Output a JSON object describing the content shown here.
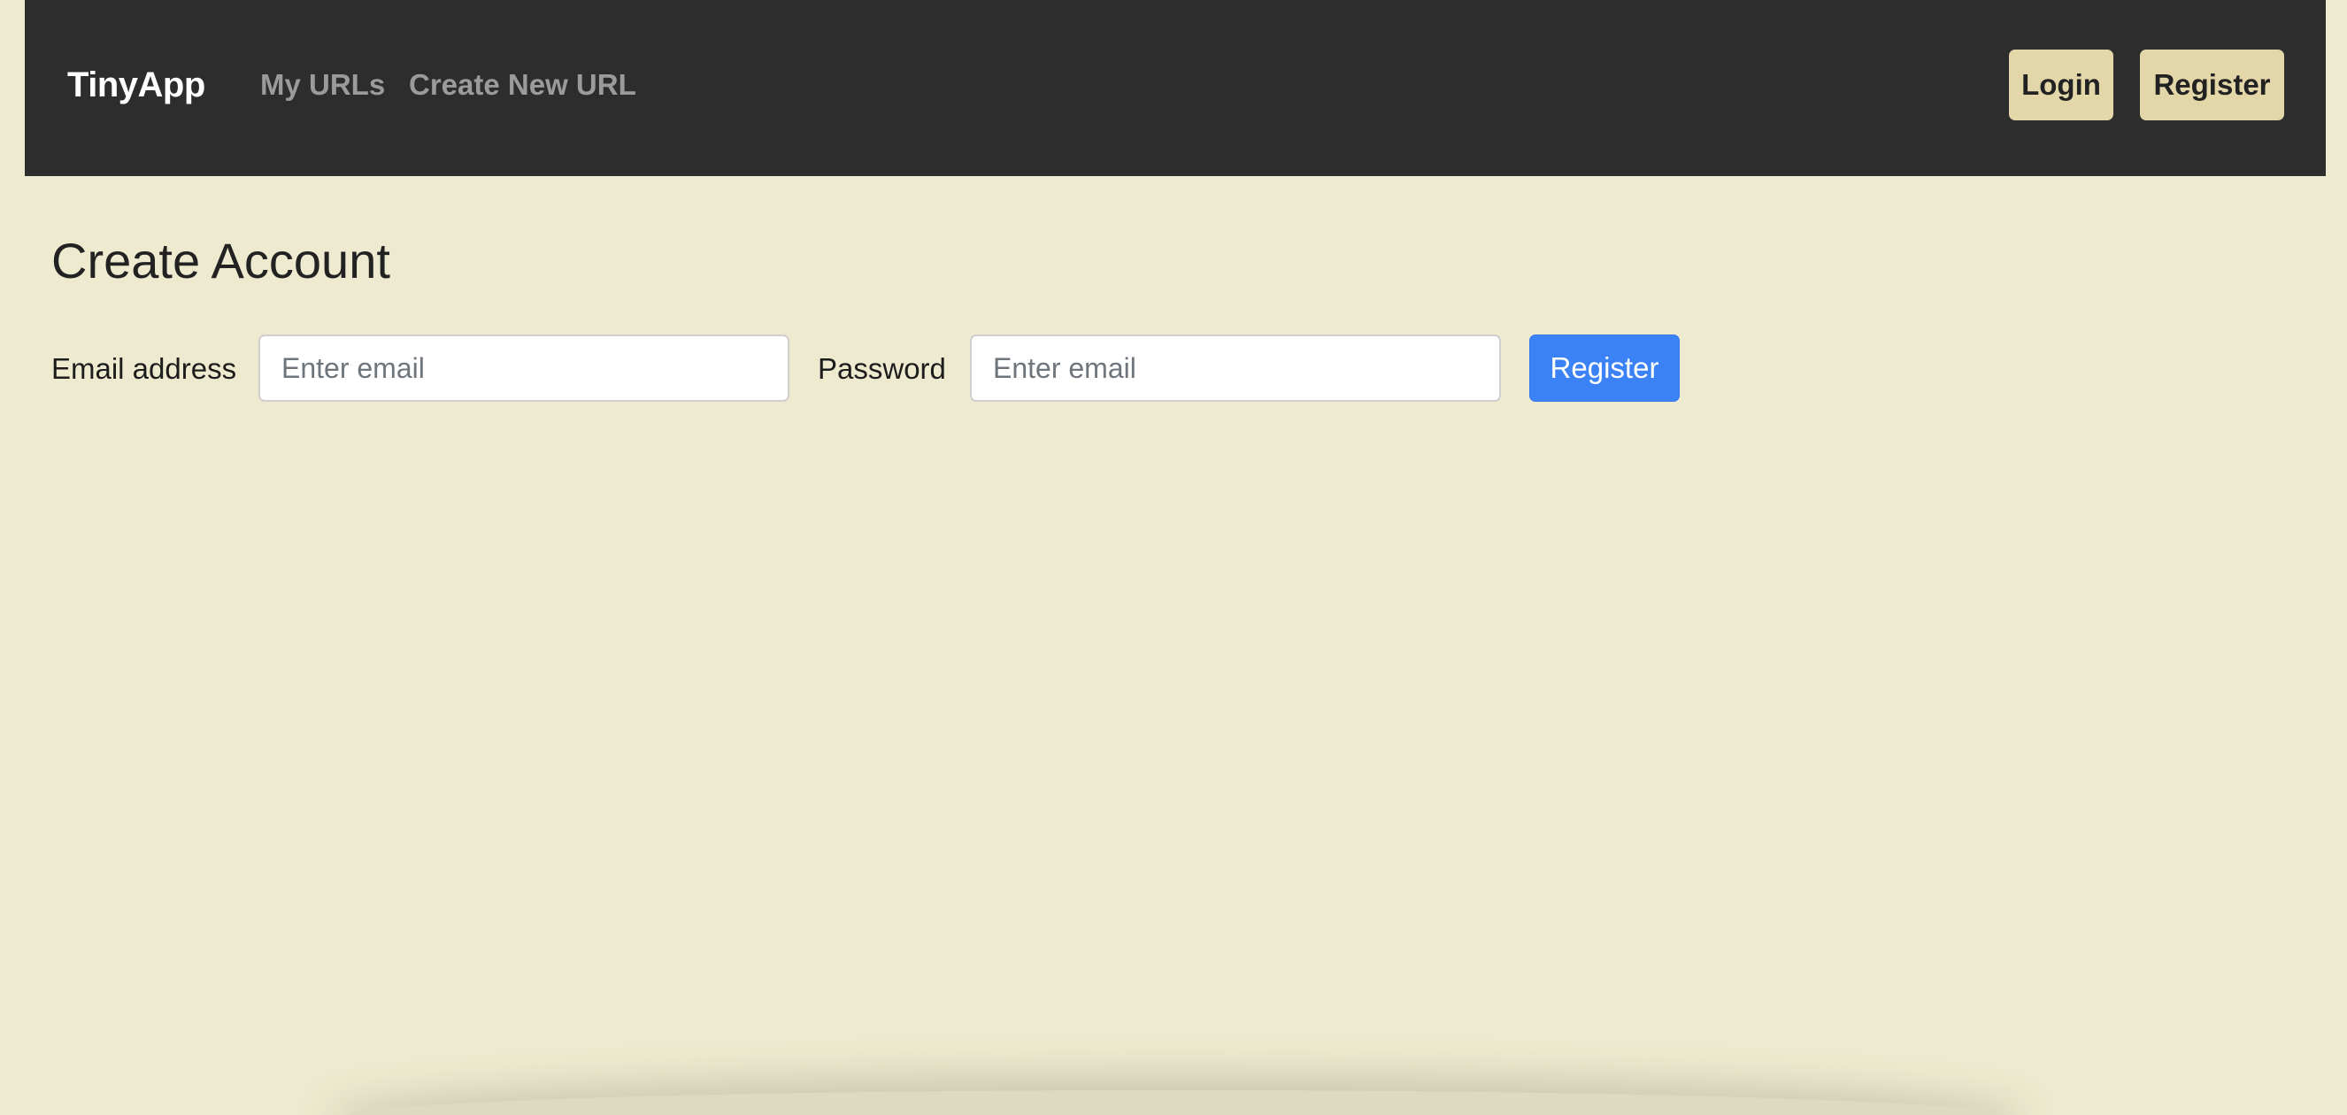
{
  "navbar": {
    "brand": "TinyApp",
    "links": [
      {
        "label": "My URLs"
      },
      {
        "label": "Create New URL"
      }
    ],
    "login_label": "Login",
    "register_label": "Register"
  },
  "main": {
    "title": "Create Account",
    "email_label": "Email address",
    "email_placeholder": "Enter email",
    "password_label": "Password",
    "password_placeholder": "Enter email",
    "submit_label": "Register"
  },
  "colors": {
    "background": "#edeacf",
    "navbar": "#2d2d2d",
    "nav_button": "#e3d7a9",
    "primary_button": "#3b82f6"
  }
}
